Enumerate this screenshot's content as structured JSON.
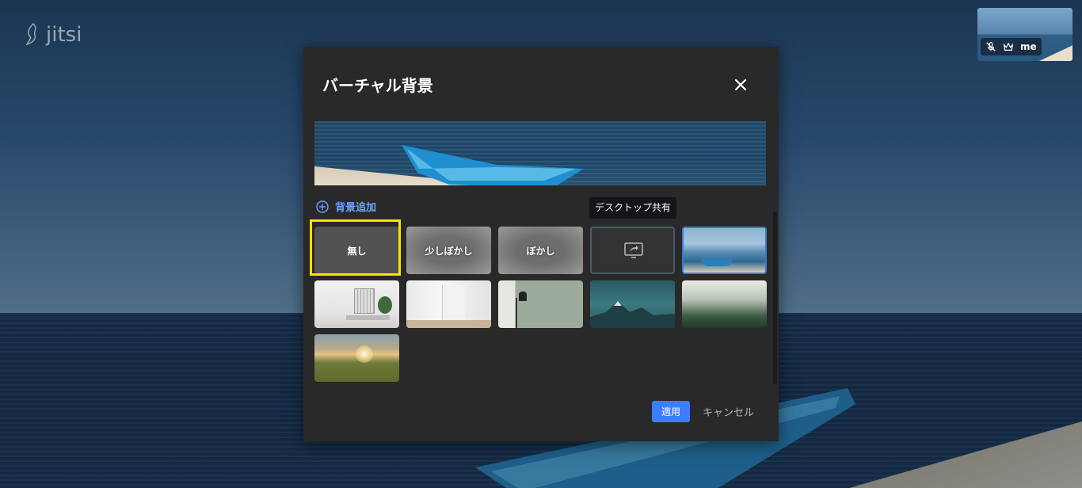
{
  "app": {
    "logo_text": "jitsi"
  },
  "self_view": {
    "name": "me",
    "icons": [
      "mic-off-icon",
      "moderator-crown-icon"
    ]
  },
  "dialog": {
    "title": "バーチャル背景",
    "add_background_label": "背景追加",
    "tooltip": "デスクトップ共有",
    "options": [
      {
        "label": "無し",
        "kind": "none",
        "selected": true
      },
      {
        "label": "少しぼかし",
        "kind": "slight-blur"
      },
      {
        "label": "ぼかし",
        "kind": "blur"
      },
      {
        "label": "",
        "kind": "desktop-share",
        "icon": "share-screen-icon"
      },
      {
        "label": "",
        "kind": "image-beach"
      },
      {
        "label": "",
        "kind": "image-room-plant"
      },
      {
        "label": "",
        "kind": "image-room-empty"
      },
      {
        "label": "",
        "kind": "image-room-lamp"
      },
      {
        "label": "",
        "kind": "image-mountains"
      },
      {
        "label": "",
        "kind": "image-forest"
      },
      {
        "label": "",
        "kind": "image-sunset-field"
      }
    ],
    "apply_label": "適用",
    "cancel_label": "キャンセル"
  },
  "colors": {
    "accent": "#3d7eff",
    "link": "#6aa6ff",
    "highlight": "#f7e400",
    "dialog_bg": "#292929"
  }
}
